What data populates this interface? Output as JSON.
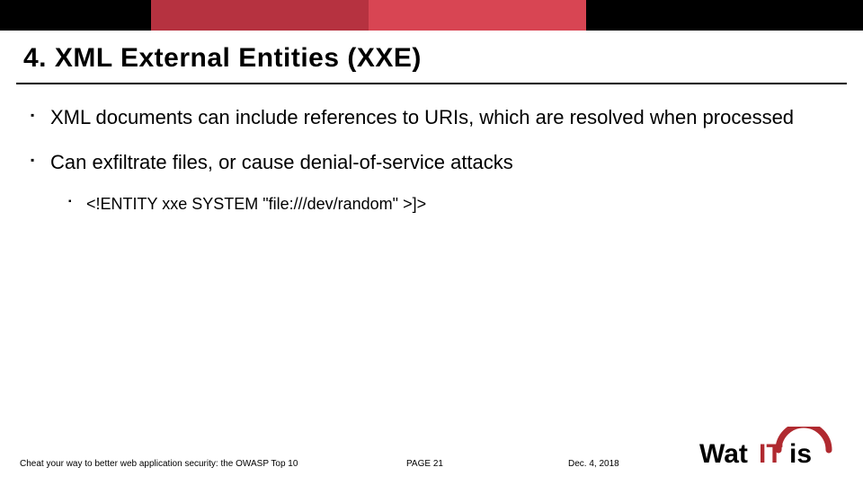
{
  "slide": {
    "title": "4. XML External Entities (XXE)",
    "bullets": [
      {
        "text": "XML documents can include references to URIs, which are resolved when processed"
      },
      {
        "text": "Can exfiltrate files, or cause denial-of-service attacks",
        "sub": [
          {
            "text": "<!ENTITY xxe SYSTEM \"file:///dev/random\" >]>"
          }
        ]
      }
    ]
  },
  "footer": {
    "presentation_title": "Cheat your way to better web application security: the OWASP Top 10",
    "page_label": "PAGE  21",
    "date": "Dec. 4, 2018"
  },
  "logo": {
    "wat": "Wat",
    "it": "IT",
    "is": "is"
  },
  "colors": {
    "accent1": "#b63240",
    "accent2": "#d84553",
    "logo_red": "#b02a30"
  }
}
